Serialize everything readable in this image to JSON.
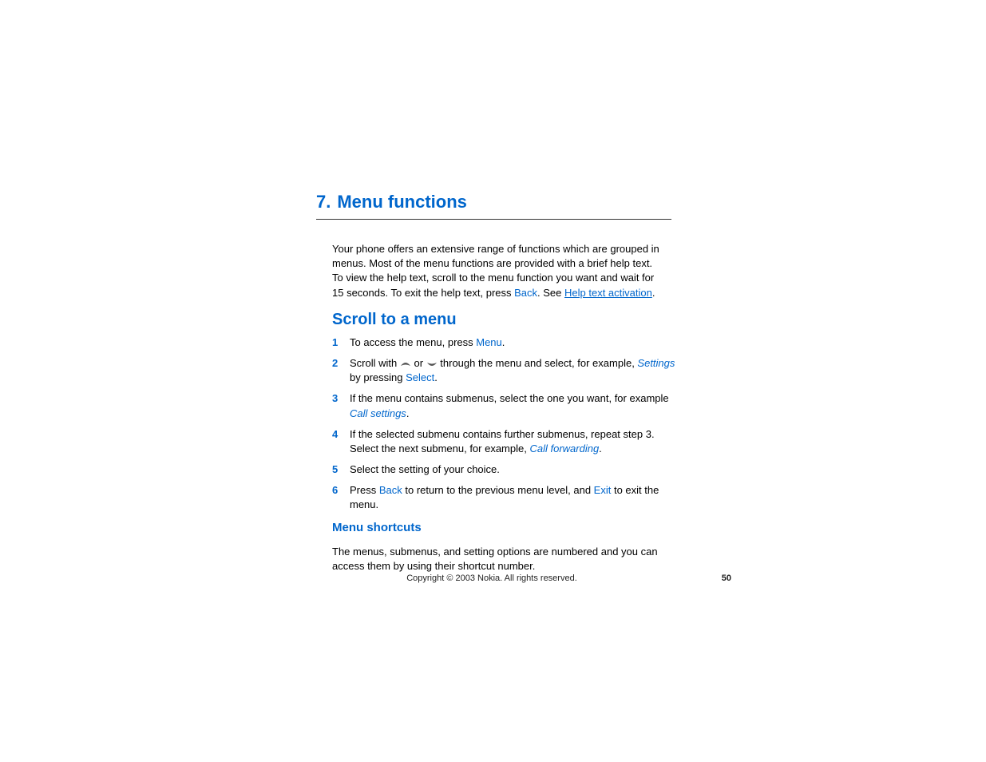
{
  "chapter": {
    "number": "7.",
    "title": "Menu functions"
  },
  "intro": {
    "part1": "Your phone offers an extensive range of functions which are grouped in menus. Most of the menu functions are provided with a brief help text. To view the help text, scroll to the menu function you want and wait for 15 seconds. To exit the help text, press ",
    "key": "Back",
    "part2": ". See ",
    "link": "Help text activation",
    "part3": "."
  },
  "section1": {
    "title": "Scroll to a menu"
  },
  "steps": [
    {
      "num": "1",
      "segments": [
        {
          "t": "text",
          "v": "To access the menu, press "
        },
        {
          "t": "key",
          "v": "Menu"
        },
        {
          "t": "text",
          "v": "."
        }
      ]
    },
    {
      "num": "2",
      "segments": [
        {
          "t": "text",
          "v": "Scroll with "
        },
        {
          "t": "arrow-up"
        },
        {
          "t": "text",
          "v": " or "
        },
        {
          "t": "arrow-down"
        },
        {
          "t": "text",
          "v": " through the menu and select, for example, "
        },
        {
          "t": "em",
          "v": "Settings"
        },
        {
          "t": "text",
          "v": " by pressing "
        },
        {
          "t": "key",
          "v": "Select"
        },
        {
          "t": "text",
          "v": "."
        }
      ]
    },
    {
      "num": "3",
      "segments": [
        {
          "t": "text",
          "v": "If the menu contains submenus, select the one you want, for example "
        },
        {
          "t": "em",
          "v": "Call settings"
        },
        {
          "t": "text",
          "v": "."
        }
      ]
    },
    {
      "num": "4",
      "segments": [
        {
          "t": "text",
          "v": "If the selected submenu contains further submenus, repeat step 3. Select the next submenu, for example, "
        },
        {
          "t": "em",
          "v": "Call forwarding"
        },
        {
          "t": "text",
          "v": "."
        }
      ]
    },
    {
      "num": "5",
      "segments": [
        {
          "t": "text",
          "v": "Select the setting of your choice."
        }
      ]
    },
    {
      "num": "6",
      "segments": [
        {
          "t": "text",
          "v": "Press "
        },
        {
          "t": "key",
          "v": "Back"
        },
        {
          "t": "text",
          "v": " to return to the previous menu level, and "
        },
        {
          "t": "key",
          "v": "Exit"
        },
        {
          "t": "text",
          "v": " to exit the menu."
        }
      ]
    }
  ],
  "section2": {
    "title": "Menu shortcuts",
    "body": "The menus, submenus, and setting options are numbered and you can access them by using their shortcut number."
  },
  "footer": {
    "copyright": "Copyright © 2003 Nokia. All rights reserved.",
    "page": "50"
  }
}
